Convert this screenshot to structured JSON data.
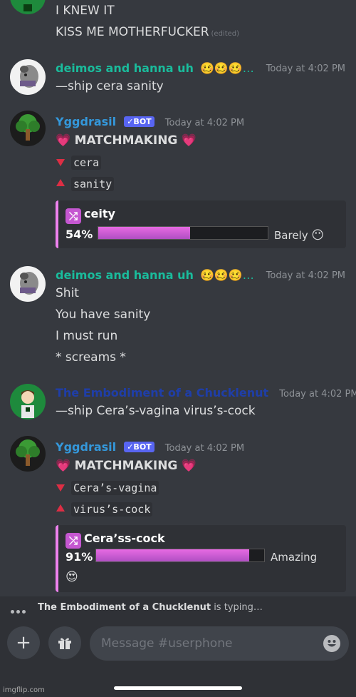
{
  "colors": {
    "background": "#36393f",
    "user_teal": "#1abc9c",
    "bot_blue": "#3498db",
    "chucklenut_blue": "#1f3ea8",
    "embed_accent": "#ee82ee",
    "bot_badge": "#5865f2"
  },
  "messages": {
    "m0": {
      "lines": [
        "I KNEW IT",
        "KISS ME MOTHERFUCKER"
      ],
      "edited": "(edited)"
    },
    "m1": {
      "username": "deimos  and hanna uh",
      "emojis": "🥴🥴🥴…",
      "timestamp": "Today at 4:02 PM",
      "text": "—ship cera sanity"
    },
    "m2": {
      "username": "Yggdrasil",
      "badge": "✓BOT",
      "timestamp": "Today at 4:02 PM",
      "heading": "MATCHMAKING",
      "heart": "💗",
      "down_name": "cera",
      "up_name": "sanity",
      "embed": {
        "title": "ceity",
        "percent": "54%",
        "fill": 0.54,
        "verdict": "Barely",
        "verdict_emoji": "😶"
      }
    },
    "m3": {
      "username": "deimos  and hanna uh",
      "emojis": "🥴🥴🥴…",
      "timestamp": "Today at 4:02 PM",
      "lines": [
        "Shit",
        "You have sanity",
        "I must run",
        "* screams *"
      ]
    },
    "m4": {
      "username": "The Embodiment of a Chucklenut",
      "timestamp": "Today at 4:02 PM",
      "text": "—ship Cera’s-vagina virus’s-cock"
    },
    "m5": {
      "username": "Yggdrasil",
      "badge": "✓BOT",
      "timestamp": "Today at 4:02 PM",
      "heading": "MATCHMAKING",
      "heart": "💗",
      "down_name": "Cera’s-vagina",
      "up_name": "virus’s-cock",
      "embed": {
        "title": "Cera’ss-cock",
        "percent": "91%",
        "fill": 0.91,
        "verdict": "Amazing",
        "verdict_emoji": "😍"
      }
    }
  },
  "typing": {
    "name": "The Embodiment of a Chucklenut",
    "suffix": " is typing…"
  },
  "composer": {
    "placeholder": "Message #userphone"
  },
  "icons": {
    "add": "plus-icon",
    "gift": "gift-icon",
    "emoji": "smiley-icon",
    "shuffle": "shuffle-icon"
  },
  "watermark": "imgflip.com"
}
